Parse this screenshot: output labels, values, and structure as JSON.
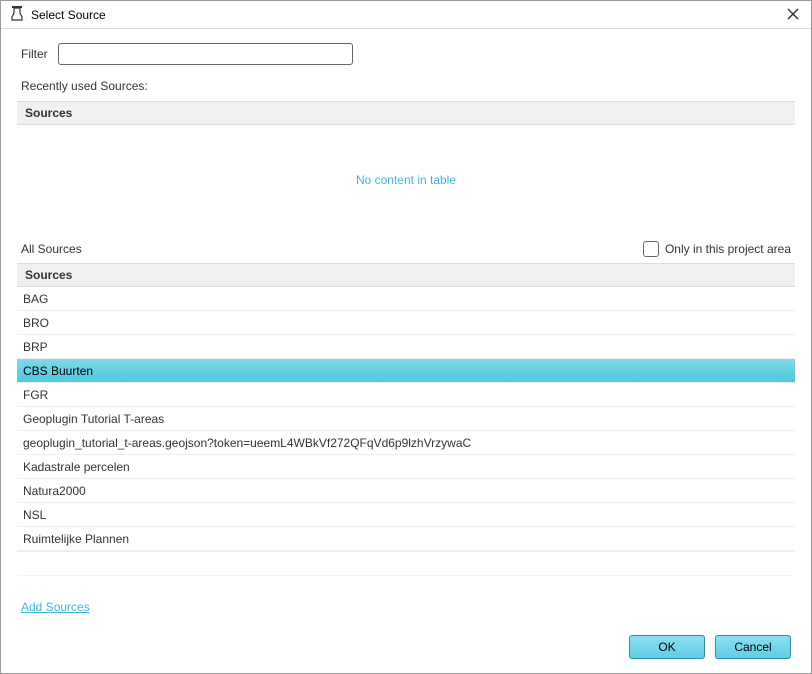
{
  "titlebar": {
    "title": "Select Source"
  },
  "filter": {
    "label": "Filter",
    "value": ""
  },
  "recent": {
    "label": "Recently used Sources:",
    "header": "Sources",
    "empty_text": "No content in table"
  },
  "allSources": {
    "label": "All Sources",
    "checkbox_label": "Only in this project area",
    "header": "Sources",
    "items": [
      {
        "label": "BAG",
        "selected": false
      },
      {
        "label": "BRO",
        "selected": false
      },
      {
        "label": "BRP",
        "selected": false
      },
      {
        "label": "CBS Buurten",
        "selected": true
      },
      {
        "label": "FGR",
        "selected": false
      },
      {
        "label": "Geoplugin Tutorial T-areas",
        "selected": false
      },
      {
        "label": "geoplugin_tutorial_t-areas.geojson?token=ueemL4WBkVf272QFqVd6p9lzhVrzywaC",
        "selected": false
      },
      {
        "label": "Kadastrale percelen",
        "selected": false
      },
      {
        "label": "Natura2000",
        "selected": false
      },
      {
        "label": "NSL",
        "selected": false
      },
      {
        "label": "Ruimtelijke Plannen",
        "selected": false
      }
    ]
  },
  "addSources": {
    "label": "Add Sources"
  },
  "buttons": {
    "ok": "OK",
    "cancel": "Cancel"
  }
}
